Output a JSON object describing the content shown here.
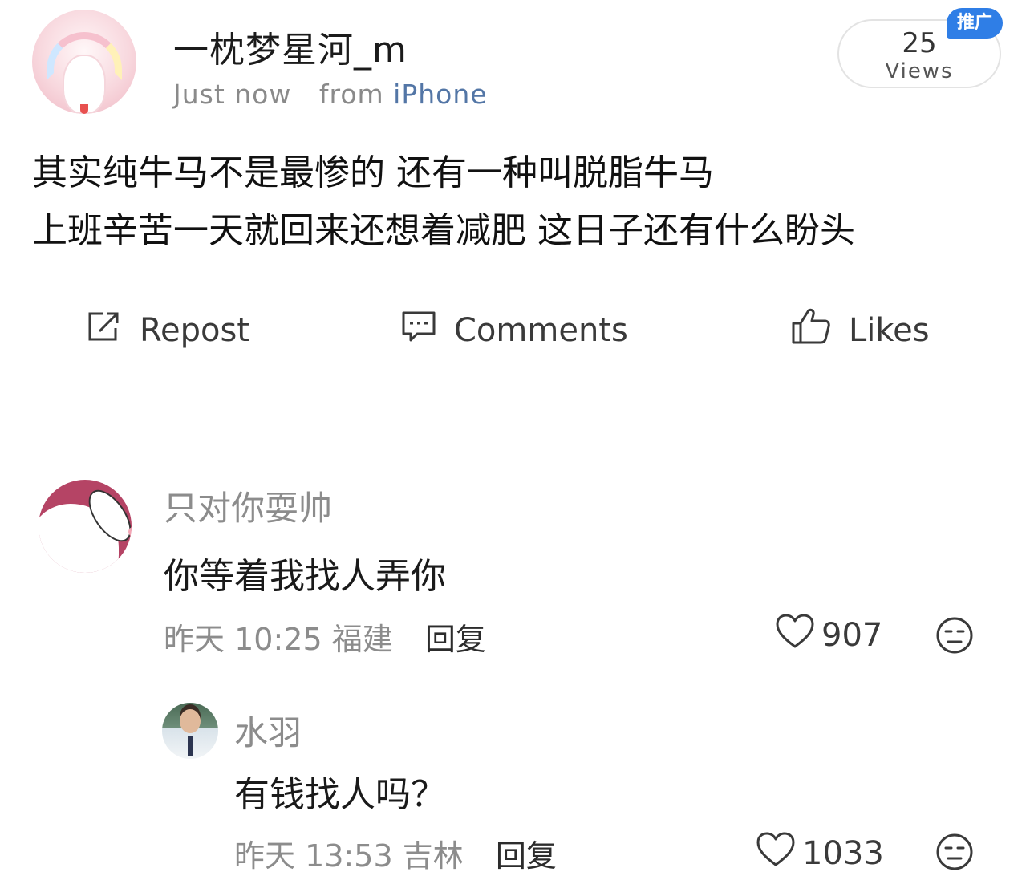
{
  "post": {
    "username": "一枕梦星河_m",
    "time": "Just now",
    "from_label": "from",
    "source": "iPhone",
    "views_count": "25",
    "views_label": "Views",
    "promo_badge": "推广",
    "lines": [
      "其实纯牛马不是最惨的 还有一种叫脱脂牛马",
      "上班辛苦一天就回来还想着减肥 这日子还有什么盼头"
    ]
  },
  "actions": {
    "repost": "Repost",
    "comments": "Comments",
    "likes": "Likes"
  },
  "comments": [
    {
      "name": "只对你耍帅",
      "text": "你等着我找人弄你",
      "date": "昨天",
      "time": "10:25",
      "location": "福建",
      "reply": "回复",
      "likes": "907"
    },
    {
      "name": "水羽",
      "text": "有钱找人吗？",
      "date": "昨天",
      "time": "13:53",
      "location": "吉林",
      "reply": "回复",
      "likes": "1033"
    }
  ],
  "icons": {
    "repost": "repost-icon",
    "comments": "comment-icon",
    "likes": "thumbs-up-icon",
    "heart": "heart-icon",
    "emoji": "emoji-face-icon"
  },
  "colors": {
    "accent": "#5376a6",
    "promo": "#2f7ee6",
    "muted": "#8c8c8c"
  }
}
